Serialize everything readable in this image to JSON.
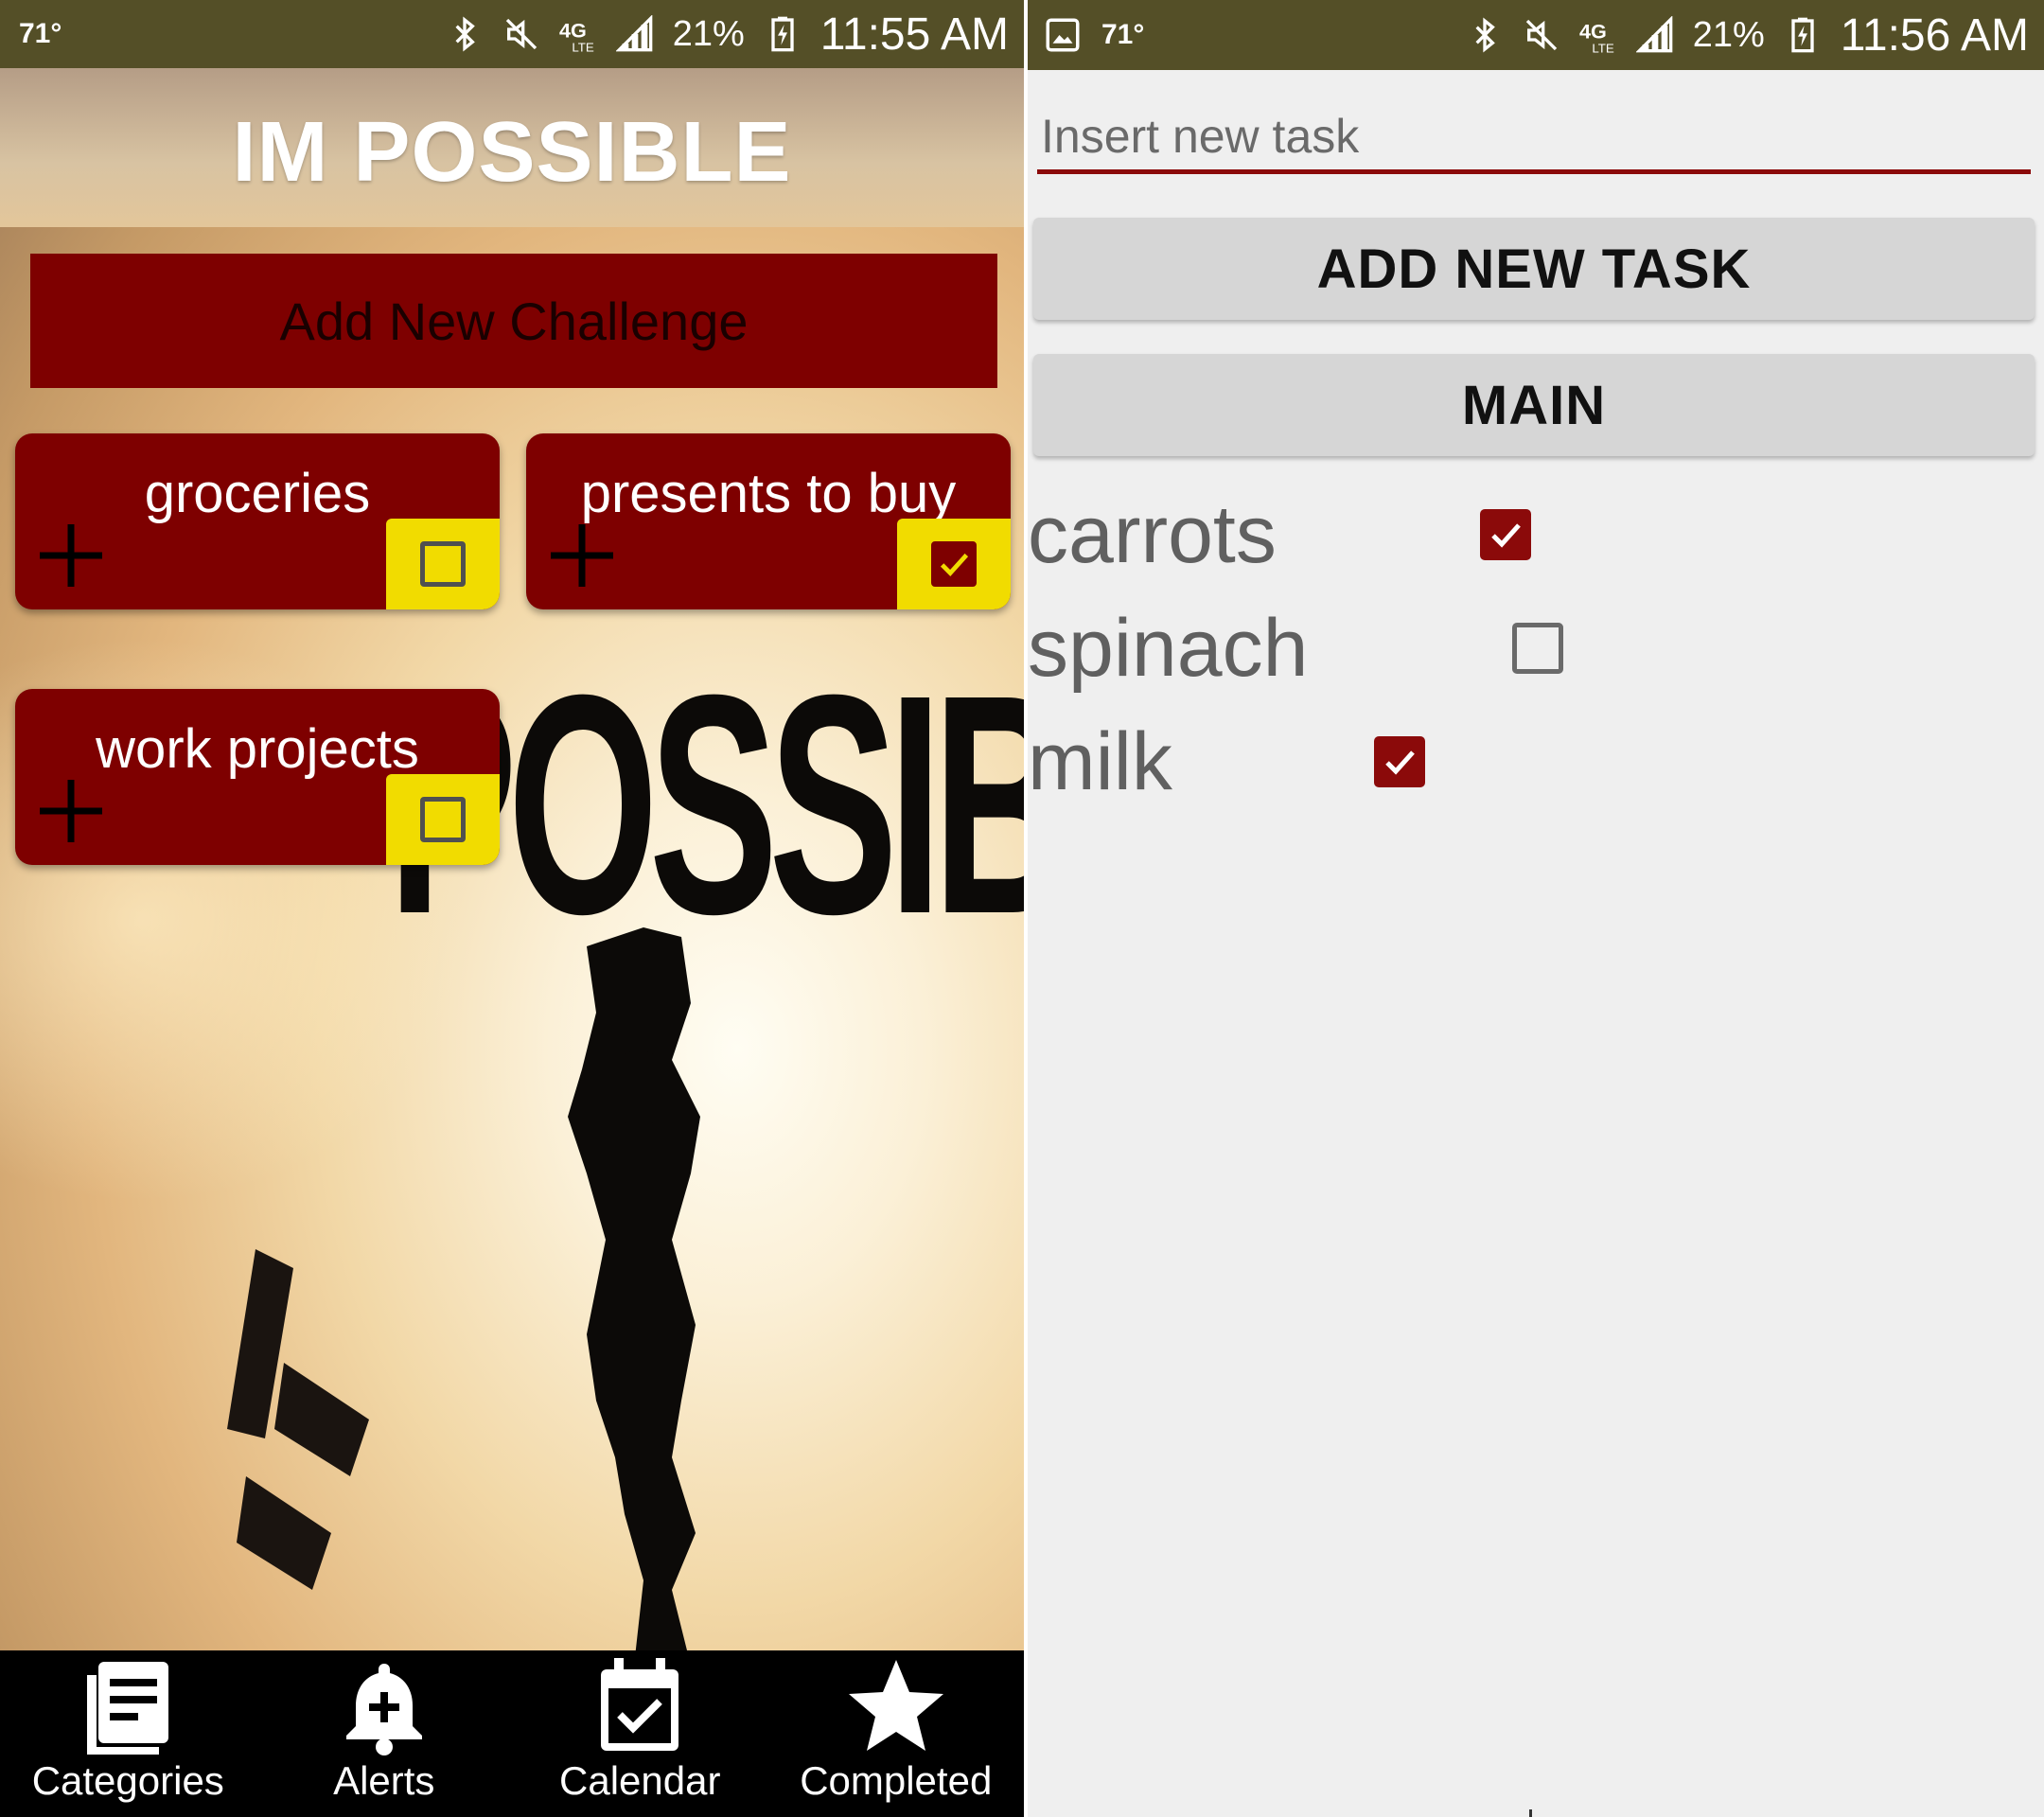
{
  "left_screen": {
    "status_bar": {
      "temperature": "71°",
      "battery": "21%",
      "time": "11:55 AM",
      "network": "4G LTE"
    },
    "app_title": "IM POSSIBLE",
    "background_word": "POSSIBLE",
    "add_challenge_label": "Add New Challenge",
    "categories": [
      {
        "label": "groceries",
        "checked": false
      },
      {
        "label": "presents to buy",
        "checked": true
      },
      {
        "label": "work projects",
        "checked": false
      }
    ],
    "bottom_nav": [
      {
        "label": "Categories",
        "icon": "list-icon"
      },
      {
        "label": "Alerts",
        "icon": "bell-plus-icon"
      },
      {
        "label": "Calendar",
        "icon": "calendar-check-icon"
      },
      {
        "label": "Completed",
        "icon": "star-icon"
      }
    ],
    "colors": {
      "primary": "#7e0000",
      "accent": "#f1dc00",
      "status_bar": "#544f27"
    }
  },
  "right_screen": {
    "status_bar": {
      "temperature": "71°",
      "battery": "21%",
      "time": "11:56 AM",
      "network": "4G LTE"
    },
    "task_input": {
      "placeholder": "Insert new task",
      "value": ""
    },
    "add_task_label": "ADD NEW TASK",
    "main_label": "MAIN",
    "tasks": [
      {
        "label": "carrots",
        "checked": true
      },
      {
        "label": "spinach",
        "checked": false
      },
      {
        "label": "milk",
        "checked": true
      }
    ],
    "colors": {
      "accent": "#8b0a0a",
      "background": "#efefef",
      "button": "#d6d6d6"
    }
  }
}
